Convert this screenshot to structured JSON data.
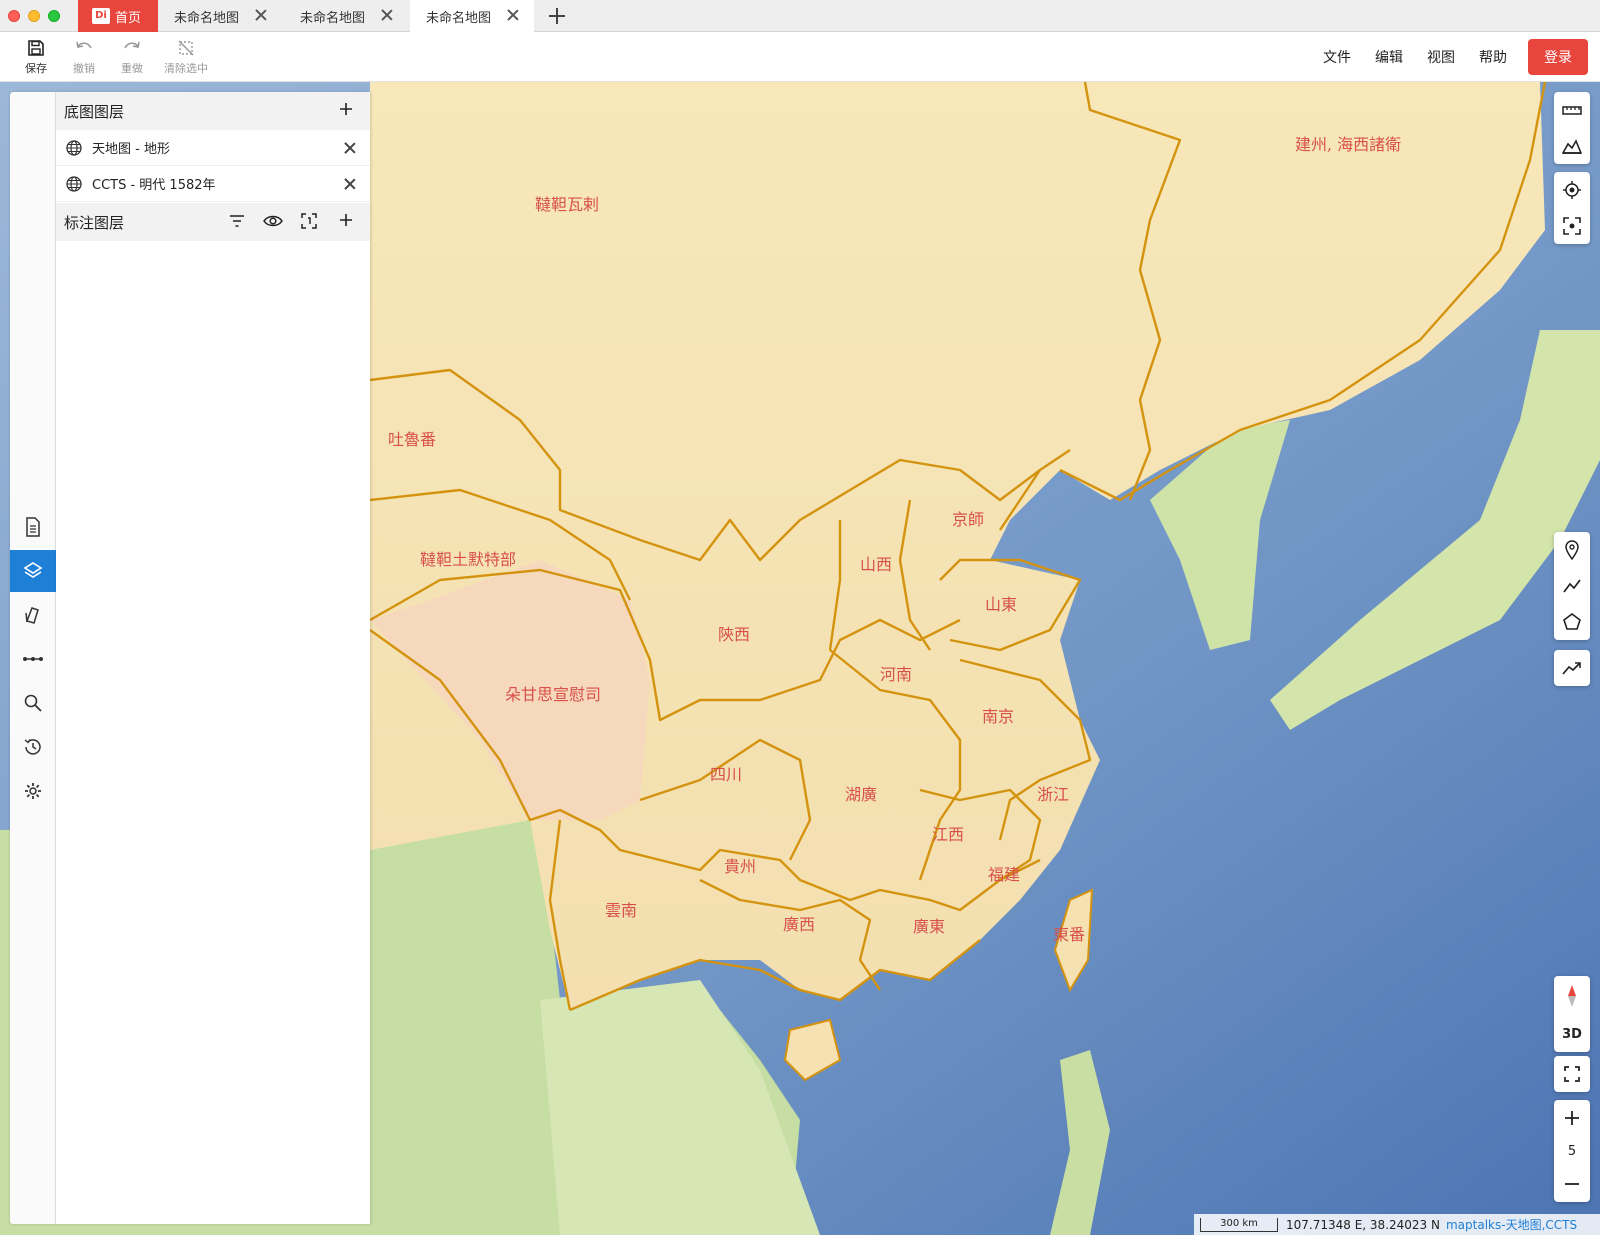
{
  "tabs": {
    "home": {
      "label": "首页",
      "logo": "Di"
    },
    "docs": [
      {
        "label": "未命名地图"
      },
      {
        "label": "未命名地图"
      },
      {
        "label": "未命名地图"
      }
    ]
  },
  "toolbar": {
    "save_label": "保存",
    "undo_label": "撤销",
    "redo_label": "重做",
    "clear_selection_label": "清除选中"
  },
  "menu": {
    "file": "文件",
    "edit": "编辑",
    "view": "视图",
    "help": "帮助",
    "login": "登录"
  },
  "layer_panel": {
    "base_layers_title": "底图图层",
    "base_layers": [
      {
        "label": "天地图 - 地形"
      },
      {
        "label": "CCTS - 明代 1582年"
      }
    ],
    "annotation_layers_title": "标注图层"
  },
  "map_labels": {
    "jianzhou": "建州, 海西諸衛",
    "wala": "韃靼瓦剌",
    "tulufan": "吐魯番",
    "tumote": "韃靼土默特部",
    "duogan": "朵甘思宣慰司",
    "jingshi": "京師",
    "shanxi": "山西",
    "shandong": "山東",
    "shaanxi": "陝西",
    "henan": "河南",
    "nanjing": "南京",
    "sichuan": "四川",
    "huguang": "湖廣",
    "zhejiang": "浙江",
    "jiangxi": "江西",
    "guizhou": "貴州",
    "fujian": "福建",
    "yunnan": "雲南",
    "guangxi": "廣西",
    "guangdong": "廣東",
    "dongfan": "東番"
  },
  "map_controls": {
    "three_d": "3D",
    "zoom_level": "5"
  },
  "status": {
    "scale": "300 km",
    "coords": "107.71348 E, 38.24023 N",
    "attribution_maptalks": "maptalks",
    "attribution_sep": " - ",
    "attribution_tianditu": "天地图",
    "attribution_comma": ", ",
    "attribution_ccts": "CCTS"
  },
  "colors": {
    "accent": "#e8453c",
    "active_blue": "#1e7fd6",
    "border_gold": "#d4930f",
    "label_red": "#d8504a"
  }
}
